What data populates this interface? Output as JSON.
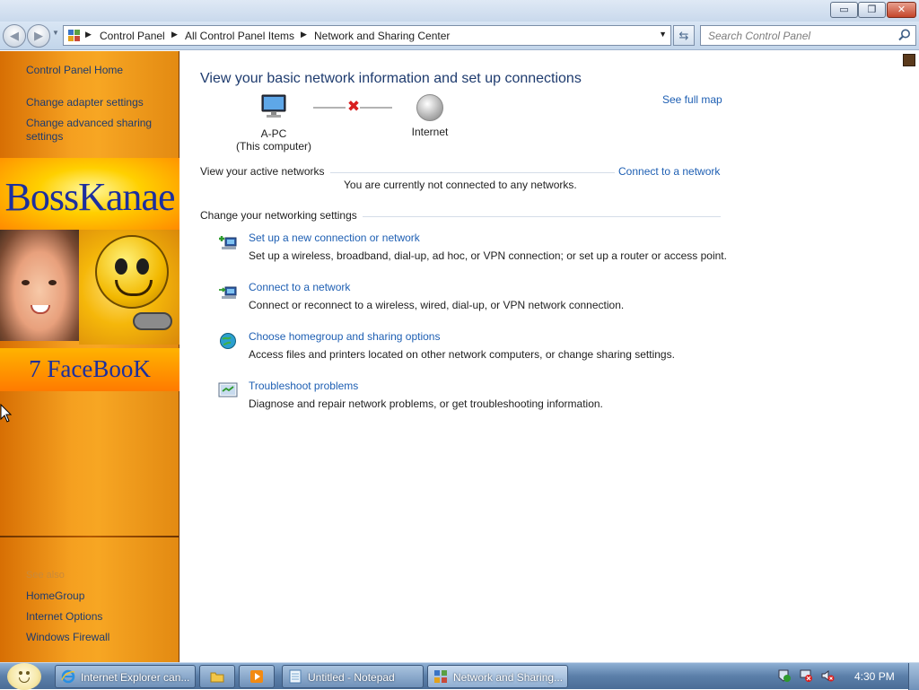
{
  "window": {
    "caption_buttons": {
      "minimize": "▭",
      "maximize": "❐",
      "close": "✕"
    }
  },
  "navigation": {
    "back_glyph": "◀",
    "forward_glyph": "▶",
    "breadcrumbs": [
      "Control Panel",
      "All Control Panel Items",
      "Network and Sharing Center"
    ],
    "search_placeholder": "Search Control Panel"
  },
  "left_pane": {
    "home": "Control Panel Home",
    "links": [
      "Change adapter settings",
      "Change advanced sharing settings"
    ],
    "see_also_label": "See also",
    "see_also": [
      "HomeGroup",
      "Internet Options",
      "Windows Firewall"
    ],
    "banner": {
      "title": "BossKanae",
      "subtitle": "7 FaceBooK"
    }
  },
  "main": {
    "title": "View your basic network information and set up connections",
    "see_full_map": "See full map",
    "map": {
      "computer_name": "A-PC",
      "computer_sub": "(This computer)",
      "internet_label": "Internet",
      "status_glyph": "✖"
    },
    "active_networks": {
      "heading": "View your active networks",
      "connect_link": "Connect to a network",
      "status": "You are currently not connected to any networks."
    },
    "change_settings": {
      "heading": "Change your networking settings",
      "tasks": [
        {
          "link": "Set up a new connection or network",
          "desc": "Set up a wireless, broadband, dial-up, ad hoc, or VPN connection; or set up a router or access point.",
          "icon": "new-connection-icon"
        },
        {
          "link": "Connect to a network",
          "desc": "Connect or reconnect to a wireless, wired, dial-up, or VPN network connection.",
          "icon": "connect-network-icon"
        },
        {
          "link": "Choose homegroup and sharing options",
          "desc": "Access files and printers located on other network computers, or change sharing settings.",
          "icon": "homegroup-icon"
        },
        {
          "link": "Troubleshoot problems",
          "desc": "Diagnose and repair network problems, or get troubleshooting information.",
          "icon": "troubleshoot-icon"
        }
      ]
    }
  },
  "taskbar": {
    "buttons": [
      {
        "label": "Internet Explorer can...",
        "icon": "internet-explorer-icon"
      },
      {
        "label": "",
        "icon": "folder-icon"
      },
      {
        "label": "",
        "icon": "media-player-icon"
      },
      {
        "label": "Untitled - Notepad",
        "icon": "notepad-icon"
      },
      {
        "label": "Network and Sharing...",
        "icon": "network-icon"
      }
    ],
    "clock": "4:30 PM"
  },
  "colors": {
    "link": "#1e5fb3",
    "heading": "#1e3b6e",
    "left_pane_orange": "#f5a020",
    "error_red": "#d81e1e"
  }
}
